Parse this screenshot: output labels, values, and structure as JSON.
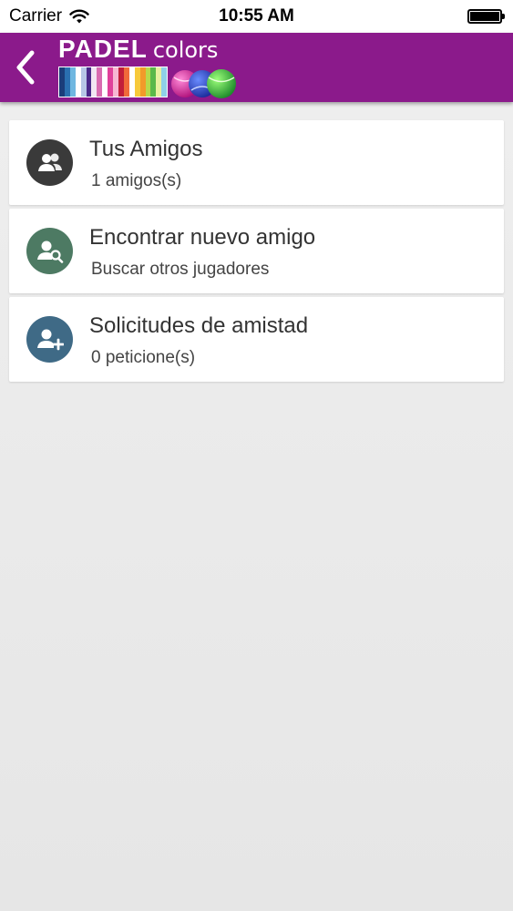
{
  "status_bar": {
    "carrier": "Carrier",
    "time": "10:55 AM"
  },
  "nav": {
    "logo_word_1": "PADEL",
    "logo_word_2": "colors",
    "background_color": "#8b1a8b"
  },
  "friends_menu": [
    {
      "title": "Tus Amigos",
      "subtitle": "1 amigos(s)",
      "icon": "group-icon",
      "icon_color": "#3a3a3a"
    },
    {
      "title": "Encontrar nuevo amigo",
      "subtitle": "Buscar otros jugadores",
      "icon": "user-search-icon",
      "icon_color": "#4d7a63"
    },
    {
      "title": "Solicitudes de amistad",
      "subtitle": "0 peticione(s)",
      "icon": "user-add-icon",
      "icon_color": "#3f6a86"
    }
  ]
}
